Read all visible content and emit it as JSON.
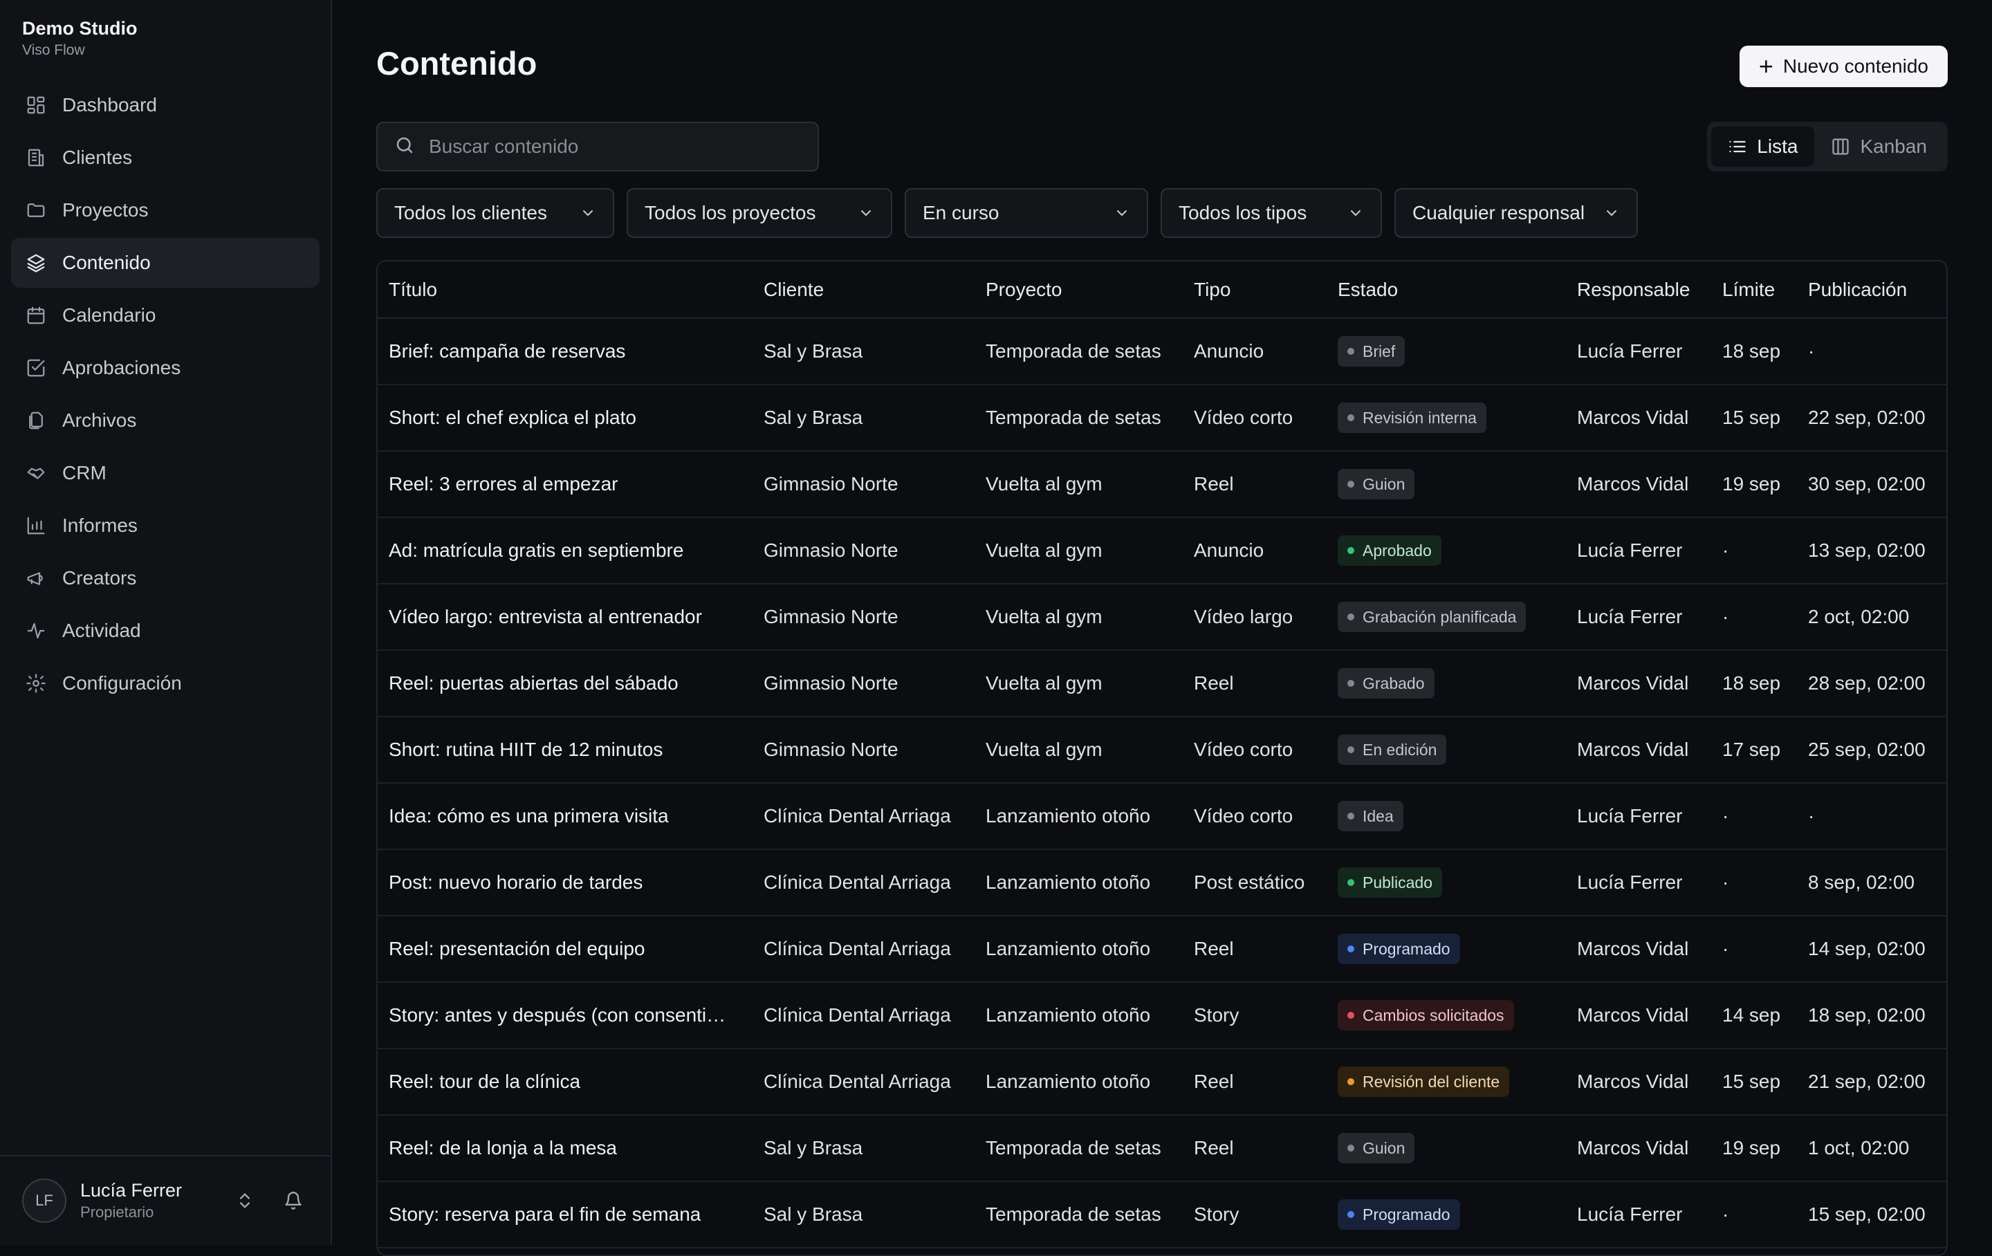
{
  "brand": {
    "name": "Demo Studio",
    "subtitle": "Viso Flow"
  },
  "nav": [
    {
      "label": "Dashboard",
      "icon": "dashboard-icon"
    },
    {
      "label": "Clientes",
      "icon": "building-icon"
    },
    {
      "label": "Proyectos",
      "icon": "folder-icon"
    },
    {
      "label": "Contenido",
      "icon": "layers-icon",
      "active": true
    },
    {
      "label": "Calendario",
      "icon": "calendar-icon"
    },
    {
      "label": "Aprobaciones",
      "icon": "check-square-icon"
    },
    {
      "label": "Archivos",
      "icon": "files-icon"
    },
    {
      "label": "CRM",
      "icon": "handshake-icon"
    },
    {
      "label": "Informes",
      "icon": "bar-chart-icon"
    },
    {
      "label": "Creators",
      "icon": "megaphone-icon"
    },
    {
      "label": "Actividad",
      "icon": "activity-icon"
    },
    {
      "label": "Configuración",
      "icon": "gear-icon"
    }
  ],
  "user": {
    "initials": "LF",
    "name": "Lucía Ferrer",
    "role": "Propietario"
  },
  "header": {
    "title": "Contenido",
    "new_button": "Nuevo contenido"
  },
  "search": {
    "placeholder": "Buscar contenido",
    "value": ""
  },
  "view": {
    "list": "Lista",
    "kanban": "Kanban",
    "active": "list"
  },
  "filters": [
    "Todos los clientes",
    "Todos los proyectos",
    "En curso",
    "Todos los tipos",
    "Cualquier responsal"
  ],
  "table": {
    "columns": [
      "Título",
      "Cliente",
      "Proyecto",
      "Tipo",
      "Estado",
      "Responsable",
      "Límite",
      "Publicación"
    ],
    "rows": [
      {
        "title": "Brief: campaña de reservas",
        "client": "Sal y Brasa",
        "project": "Temporada de setas",
        "type": "Anuncio",
        "status": "Brief",
        "status_color": "gray",
        "owner": "Lucía Ferrer",
        "deadline": "18 sep",
        "publish": "·"
      },
      {
        "title": "Short: el chef explica el plato",
        "client": "Sal y Brasa",
        "project": "Temporada de setas",
        "type": "Vídeo corto",
        "status": "Revisión interna",
        "status_color": "gray",
        "owner": "Marcos Vidal",
        "deadline": "15 sep",
        "publish": "22 sep, 02:00"
      },
      {
        "title": "Reel: 3 errores al empezar",
        "client": "Gimnasio Norte",
        "project": "Vuelta al gym",
        "type": "Reel",
        "status": "Guion",
        "status_color": "gray",
        "owner": "Marcos Vidal",
        "deadline": "19 sep",
        "publish": "30 sep, 02:00"
      },
      {
        "title": "Ad: matrícula gratis en septiembre",
        "client": "Gimnasio Norte",
        "project": "Vuelta al gym",
        "type": "Anuncio",
        "status": "Aprobado",
        "status_color": "green",
        "owner": "Lucía Ferrer",
        "deadline": "·",
        "publish": "13 sep, 02:00"
      },
      {
        "title": "Vídeo largo: entrevista al entrenador",
        "client": "Gimnasio Norte",
        "project": "Vuelta al gym",
        "type": "Vídeo largo",
        "status": "Grabación planificada",
        "status_color": "gray",
        "owner": "Lucía Ferrer",
        "deadline": "·",
        "publish": "2 oct, 02:00"
      },
      {
        "title": "Reel: puertas abiertas del sábado",
        "client": "Gimnasio Norte",
        "project": "Vuelta al gym",
        "type": "Reel",
        "status": "Grabado",
        "status_color": "gray",
        "owner": "Marcos Vidal",
        "deadline": "18 sep",
        "publish": "28 sep, 02:00"
      },
      {
        "title": "Short: rutina HIIT de 12 minutos",
        "client": "Gimnasio Norte",
        "project": "Vuelta al gym",
        "type": "Vídeo corto",
        "status": "En edición",
        "status_color": "gray",
        "owner": "Marcos Vidal",
        "deadline": "17 sep",
        "publish": "25 sep, 02:00"
      },
      {
        "title": "Idea: cómo es una primera visita",
        "client": "Clínica Dental Arriaga",
        "project": "Lanzamiento otoño",
        "type": "Vídeo corto",
        "status": "Idea",
        "status_color": "gray",
        "owner": "Lucía Ferrer",
        "deadline": "·",
        "publish": "·"
      },
      {
        "title": "Post: nuevo horario de tardes",
        "client": "Clínica Dental Arriaga",
        "project": "Lanzamiento otoño",
        "type": "Post estático",
        "status": "Publicado",
        "status_color": "green",
        "owner": "Lucía Ferrer",
        "deadline": "·",
        "publish": "8 sep, 02:00"
      },
      {
        "title": "Reel: presentación del equipo",
        "client": "Clínica Dental Arriaga",
        "project": "Lanzamiento otoño",
        "type": "Reel",
        "status": "Programado",
        "status_color": "blue",
        "owner": "Marcos Vidal",
        "deadline": "·",
        "publish": "14 sep, 02:00"
      },
      {
        "title": "Story: antes y después (con consenti…",
        "client": "Clínica Dental Arriaga",
        "project": "Lanzamiento otoño",
        "type": "Story",
        "status": "Cambios solicitados",
        "status_color": "red",
        "owner": "Marcos Vidal",
        "deadline": "14 sep",
        "publish": "18 sep, 02:00"
      },
      {
        "title": "Reel: tour de la clínica",
        "client": "Clínica Dental Arriaga",
        "project": "Lanzamiento otoño",
        "type": "Reel",
        "status": "Revisión del cliente",
        "status_color": "orange",
        "owner": "Marcos Vidal",
        "deadline": "15 sep",
        "publish": "21 sep, 02:00"
      },
      {
        "title": "Reel: de la lonja a la mesa",
        "client": "Sal y Brasa",
        "project": "Temporada de setas",
        "type": "Reel",
        "status": "Guion",
        "status_color": "gray",
        "owner": "Marcos Vidal",
        "deadline": "19 sep",
        "publish": "1 oct, 02:00"
      },
      {
        "title": "Story: reserva para el fin de semana",
        "client": "Sal y Brasa",
        "project": "Temporada de setas",
        "type": "Story",
        "status": "Programado",
        "status_color": "blue",
        "owner": "Lucía Ferrer",
        "deadline": "·",
        "publish": "15 sep, 02:00"
      }
    ]
  }
}
